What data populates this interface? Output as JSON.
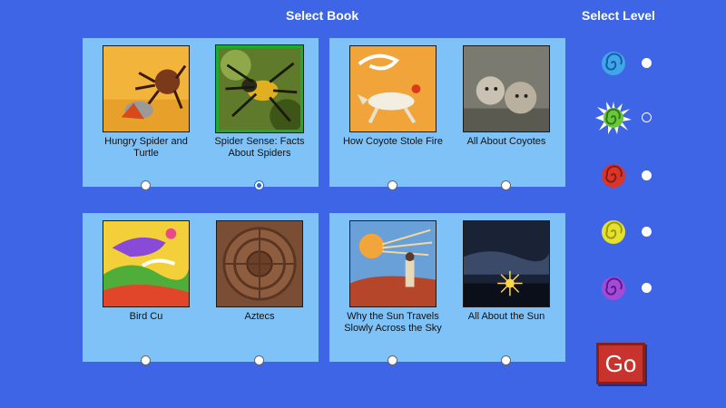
{
  "headings": {
    "select_book": "Select Book",
    "select_level": "Select Level"
  },
  "books": [
    {
      "title": "Hungry Spider and Turtle",
      "selected": false
    },
    {
      "title": "Spider Sense: Facts About Spiders",
      "selected": true
    },
    {
      "title": "How Coyote Stole Fire",
      "selected": false
    },
    {
      "title": "All About Coyotes",
      "selected": false
    },
    {
      "title": "Bird Cu",
      "selected": false
    },
    {
      "title": "Aztecs",
      "selected": false
    },
    {
      "title": "Why the Sun Travels Slowly Across the Sky",
      "selected": false
    },
    {
      "title": "All About the Sun",
      "selected": false
    }
  ],
  "levels": [
    {
      "color": "#3fa7e8",
      "selected": false
    },
    {
      "color": "#6cc63a",
      "selected": true
    },
    {
      "color": "#d8362a",
      "selected": false
    },
    {
      "color": "#e6e22c",
      "selected": false
    },
    {
      "color": "#a34ad8",
      "selected": false
    }
  ],
  "go_label": "Go",
  "colors": {
    "background": "#3d65e6",
    "panel": "#7fc2f7",
    "go": "#c8342d",
    "selected_border": "#1faa2a"
  }
}
